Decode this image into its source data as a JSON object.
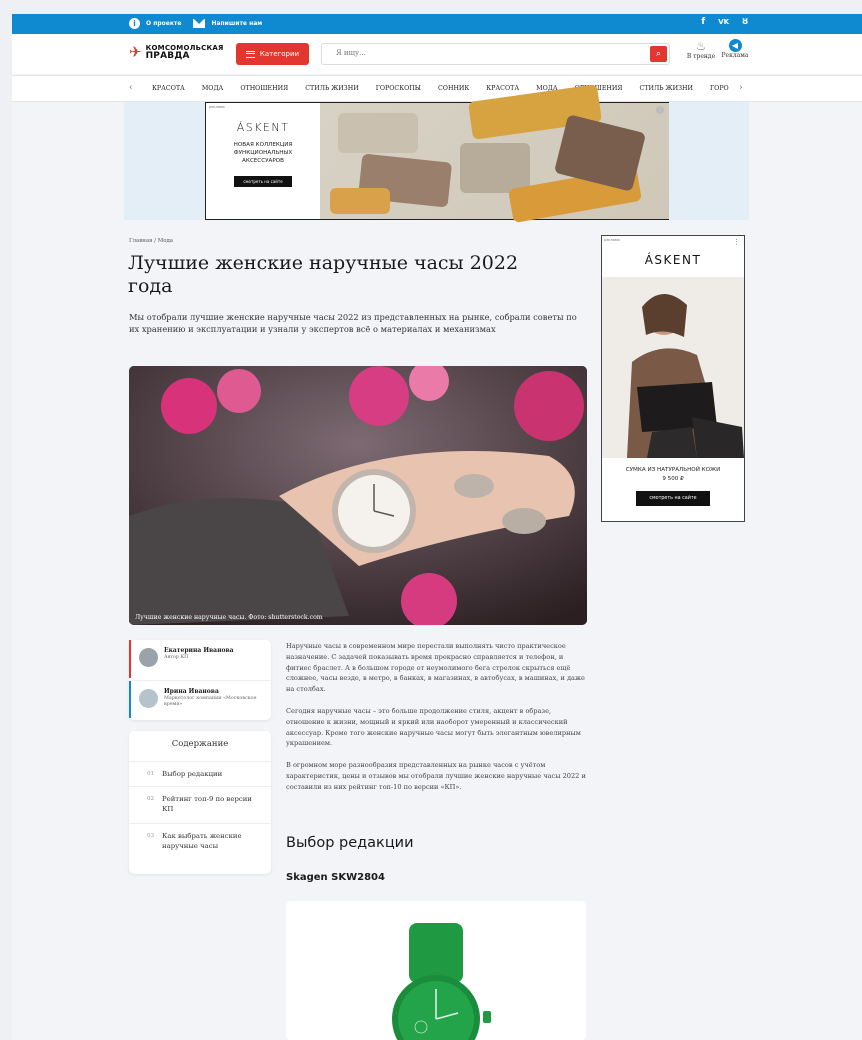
{
  "topbar": {
    "about_label": "О проекте",
    "write_label": "Напишите нам",
    "social": [
      "f",
      "vk",
      "ok"
    ]
  },
  "header": {
    "logo_line1": "КОМСОМОЛЬСКАЯ",
    "logo_line2": "ПРАВДА",
    "categories_label": "Категории",
    "search_placeholder": "Я ищу...",
    "trend_label": "В тренде",
    "ads_label": "Реклама",
    "accent_color": "#e2372f",
    "topbar_color": "#0f89cf"
  },
  "menu": {
    "items": [
      "КРАСОТА",
      "МОДА",
      "ОТНОШЕНИЯ",
      "СТИЛЬ ЖИЗНИ",
      "ГОРОСКОПЫ",
      "СОННИК",
      "КРАСОТА",
      "МОДА",
      "ОТНОШЕНИЯ",
      "СТИЛЬ ЖИЗНИ",
      "ГОРО"
    ]
  },
  "banner": {
    "ad_label": "реклама",
    "brand": "ÁSKENT",
    "text": "НОВАЯ КОЛЛЕКЦИЯ ФУНКЦИОНАЛЬНЫХ АКСЕССУАРОВ",
    "cta": "смотреть на сайте"
  },
  "article": {
    "breadcrumb": "Главная / Мода",
    "title": "Лучшие женские наручные часы 2022 года",
    "lead": "Мы отобрали лучшие женские наручные часы 2022 из представленных на рынке, собрали советы по их хранению и эксплуатации и узнали у экспертов всё о материалах и механизмах",
    "photo_caption": "Лучшие женские наручные часы. Фото: shutterstock.com",
    "paragraphs": [
      "Наручные часы в современном мире перестали выполнять чисто практическое назначение. С задачей показывать время прекрасно справляется и телефон, и фитнес браслет. А в большом городе от неумолимого бега стрелок скрыться ещё сложнее, часы везде, в метро, в банках, в магазинах, в автобусах, в машинах, и даже на столбах.",
      "Сегодня наручные часы – это больше продолжение стиля, акцент в образе, отношение к жизни, мощный и яркий или наоборот умеренный и классический аксессуар. Кроме того женские наручные часы могут быть элегантным ювелирным украшением.",
      "В огромном море разнообразия представленных на рынке часов с учётом характеристик, цены и отзывов мы отобрали лучшие женские наручные часы 2022 и составили из них рейтинг топ-10 по версии «КП»."
    ],
    "section_title": "Выбор редакции",
    "product_title": "Skagen SKW2804"
  },
  "authors": [
    {
      "name": "Екатерина Иванова",
      "role": "Автор КП",
      "bar_color": "#e2372f"
    },
    {
      "name": "Ирина Иванова",
      "role": "Маркетолог компании «Московское время»",
      "bar_color": "#0f89cf"
    }
  ],
  "toc": {
    "heading": "Содержание",
    "items": [
      {
        "num": "01",
        "text": "Выбор редакции"
      },
      {
        "num": "02",
        "text": "Рейтинг топ-9 по версии КП"
      },
      {
        "num": "03",
        "text": "Как выбрать женские наручные часы"
      }
    ]
  },
  "sidead": {
    "ad_label": "реклама",
    "brand": "ÁSKENT",
    "product": "СУМКА ИЗ НАТУРАЛЬНОЙ КОЖИ",
    "price": "9 500 ₽",
    "cta": "смотреть на сайте"
  }
}
